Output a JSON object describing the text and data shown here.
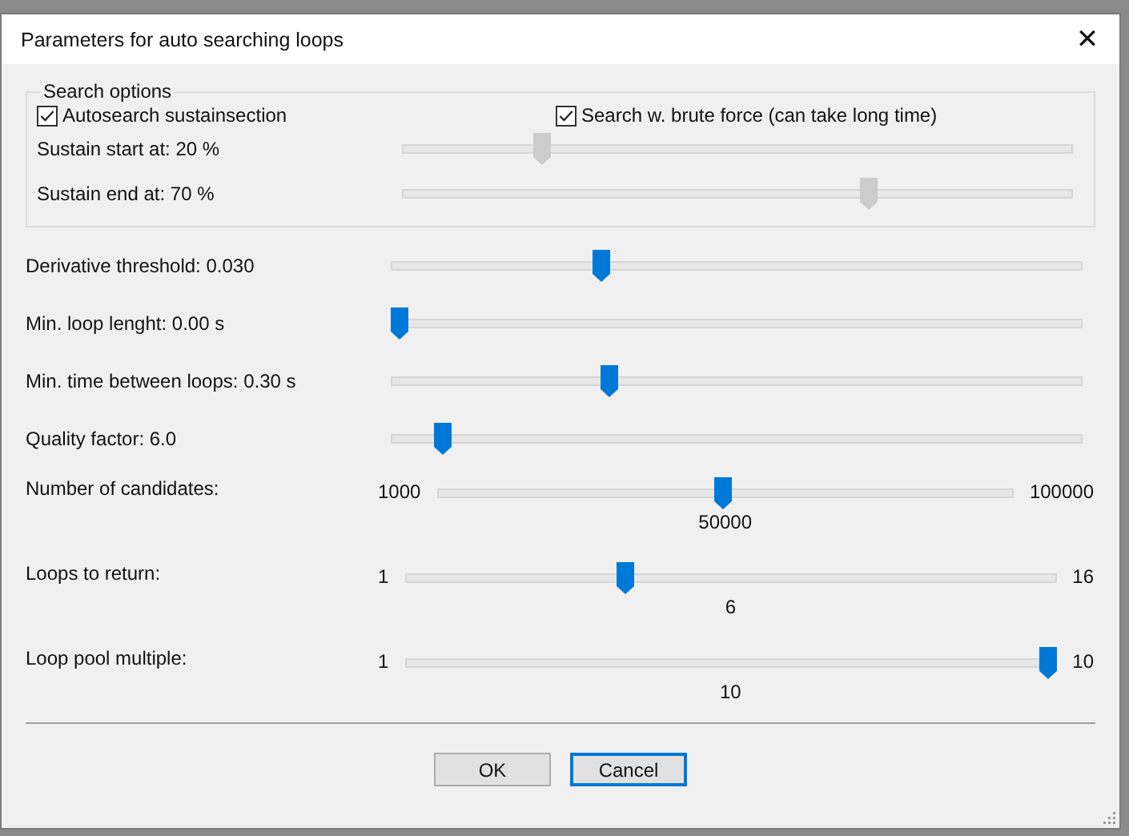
{
  "window": {
    "title": "Parameters for auto searching loops",
    "close_glyph": "✕"
  },
  "search_options": {
    "title": "Search options",
    "checkboxes": [
      {
        "label": "Autosearch sustainsection",
        "checked": true
      },
      {
        "label": "Search w. brute force (can take long time)",
        "checked": true
      }
    ],
    "sliders": [
      {
        "label": "Sustain start at: 20 %",
        "level": 0.2,
        "disabled": true
      },
      {
        "label": "Sustain end at: 70 %",
        "level": 0.7,
        "disabled": true
      }
    ]
  },
  "sliders": [
    {
      "kind": "plain",
      "label": "Derivative threshold: 0.030",
      "level": 0.3
    },
    {
      "kind": "plain",
      "label": "Min. loop lenght: 0.00 s",
      "level": 0
    },
    {
      "kind": "plain",
      "label": "Min. time between loops: 0.30 s",
      "level": 0.31
    },
    {
      "kind": "plain",
      "label": "Quality factor: 6.0",
      "level": 0.065
    },
    {
      "kind": "ranged",
      "label": "Number of candidates:",
      "min": "1000",
      "max": "100000",
      "value": "50000",
      "level": 0.495
    },
    {
      "kind": "ranged",
      "label": "Loops to return:",
      "min": "1",
      "max": "16",
      "value": "6",
      "level": 0.333
    },
    {
      "kind": "ranged",
      "label": "Loop pool multiple:",
      "min": "1",
      "max": "10",
      "value": "10",
      "level": 1
    }
  ],
  "buttons": [
    {
      "label": "OK",
      "focused": false
    },
    {
      "label": "Cancel",
      "focused": true
    }
  ]
}
